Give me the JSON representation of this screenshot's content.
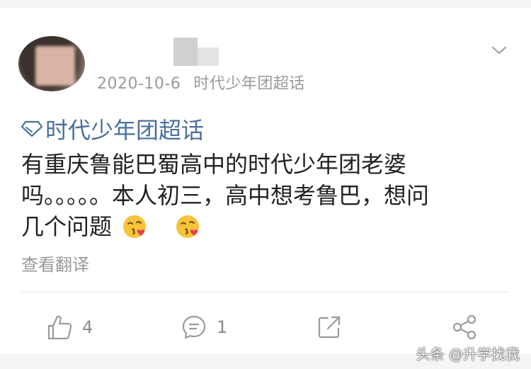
{
  "post": {
    "date": "2020-10-6",
    "source": "时代少年团超话",
    "topic_label": "时代少年团超话",
    "lines": [
      "有重庆鲁能巴蜀高中的时代少年团老婆",
      "吗。。。。。本人初三，高中想考鲁巴，想问",
      "几个问题"
    ],
    "emoji_names": [
      "kissing-heart-emoji",
      "kissing-heart-emoji"
    ],
    "translate_label": "查看翻译"
  },
  "actions": {
    "like_count": "4",
    "comment_count": "1"
  },
  "watermark": "头条 @升学找我",
  "colors": {
    "topic": "#4a6f9e",
    "meta": "#9a9a9a",
    "text": "#222222",
    "icon": "#9a9a9a"
  }
}
